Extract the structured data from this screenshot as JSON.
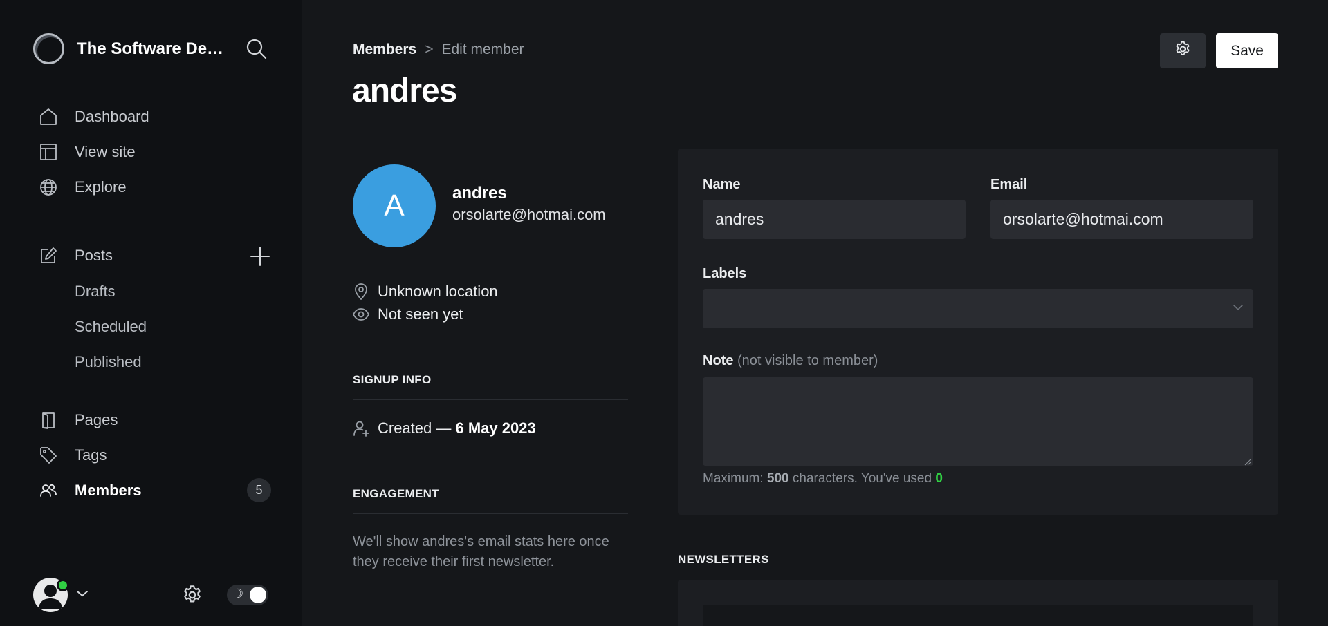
{
  "app": {
    "site_title": "The Software Desi...",
    "accent_color": "#30cf43",
    "avatar_color": "#3a9ee0"
  },
  "sidebar": {
    "items": [
      {
        "label": "Dashboard",
        "icon": "home-icon"
      },
      {
        "label": "View site",
        "icon": "layout-icon"
      },
      {
        "label": "Explore",
        "icon": "globe-icon"
      },
      {
        "label": "Posts",
        "icon": "edit-icon"
      },
      {
        "label": "Pages",
        "icon": "page-icon"
      },
      {
        "label": "Tags",
        "icon": "tag-icon"
      },
      {
        "label": "Members",
        "icon": "members-icon",
        "count": "5"
      }
    ],
    "post_subitems": [
      "Drafts",
      "Scheduled",
      "Published"
    ],
    "theme_moon": "☽"
  },
  "header": {
    "breadcrumb_parent": "Members",
    "breadcrumb_separator": ">",
    "breadcrumb_current": "Edit member",
    "title": "andres",
    "save_label": "Save"
  },
  "member": {
    "initial": "A",
    "name": "andres",
    "email": "orsolarte@hotmai.com",
    "location": "Unknown location",
    "seen": "Not seen yet",
    "signup_heading": "SIGNUP INFO",
    "created_prefix": "Created —",
    "created_date": "6 May 2023",
    "engagement_heading": "ENGAGEMENT",
    "engagement_text": "We'll show andres's email stats here once they receive their first newsletter."
  },
  "form": {
    "name_label": "Name",
    "name_value": "andres",
    "email_label": "Email",
    "email_value": "orsolarte@hotmai.com",
    "labels_label": "Labels",
    "note_label": "Note",
    "note_muted": "(not visible to member)",
    "note_hint_prefix": "Maximum:",
    "note_max": "500",
    "note_hint_middle": "characters. You've used",
    "note_used": "0"
  },
  "newsletters": {
    "heading": "NEWSLETTERS"
  }
}
